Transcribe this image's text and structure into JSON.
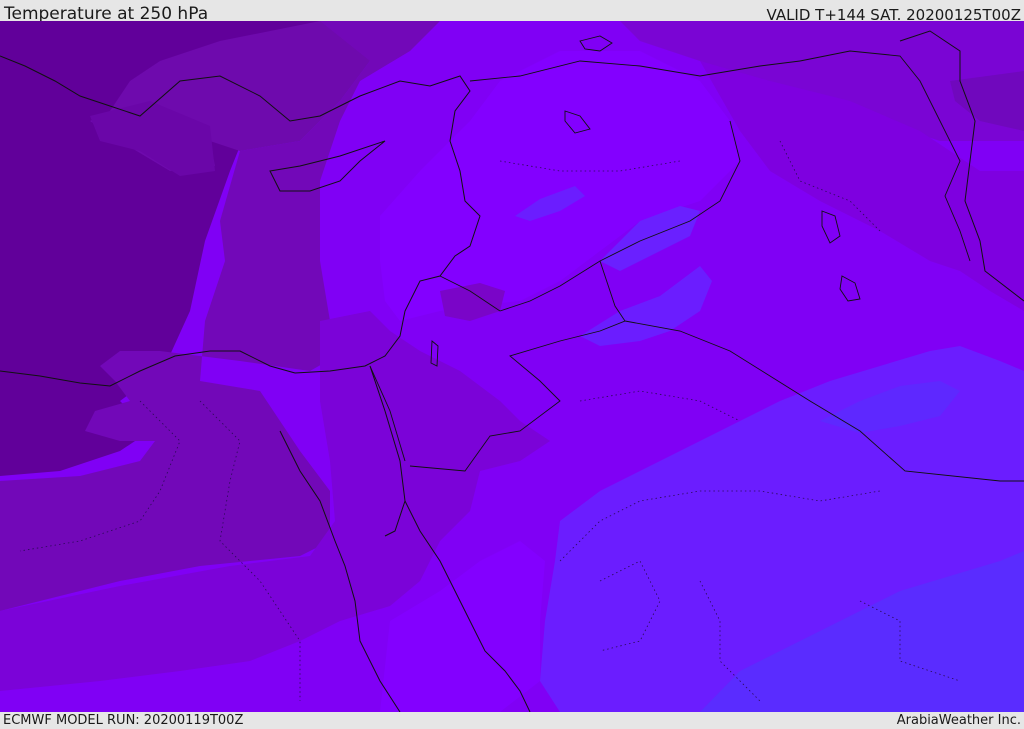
{
  "header": {
    "title": "Temperature at 250 hPa",
    "valid_time": "VALID T+144 SAT. 20200125T00Z"
  },
  "footer": {
    "model_run": "ECMWF MODEL RUN: 20200119T00Z",
    "credit": "ArabiaWeather Inc."
  },
  "map": {
    "field": "temperature",
    "level": "250 hPa",
    "colors": {
      "darkest": "#61009a",
      "dark": "#6e0aad",
      "mid_dark": "#7a07c6",
      "mid": "#7f00e6",
      "bright": "#8500ff",
      "blue_violet": "#6b1dff",
      "blue": "#5a2cff",
      "coast": "#111111"
    }
  }
}
